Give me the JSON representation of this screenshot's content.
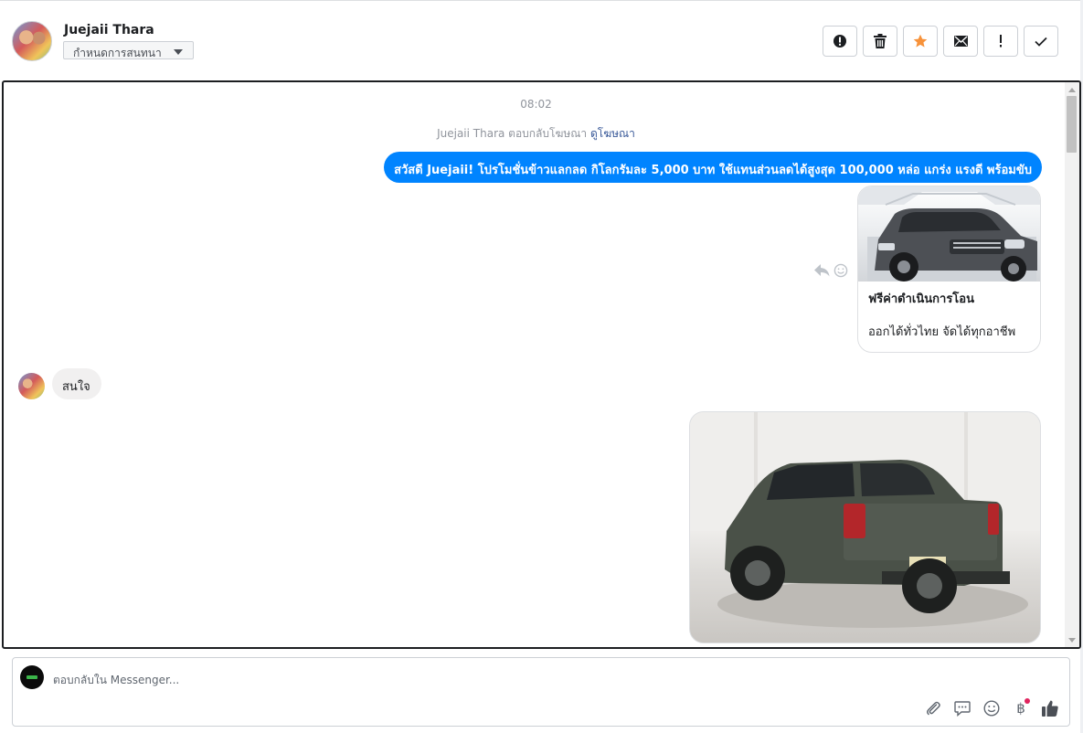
{
  "header": {
    "user_name": "Juejaii Thara",
    "label_select": "กำหนดการสนทนา",
    "toolbar": [
      {
        "name": "mark-spam-button",
        "icon": "alert-circle-icon"
      },
      {
        "name": "delete-button",
        "icon": "trash-icon"
      },
      {
        "name": "star-button",
        "icon": "star-icon",
        "color": "#f7923a"
      },
      {
        "name": "mark-unread-button",
        "icon": "envelope-icon"
      },
      {
        "name": "mark-important-button",
        "icon": "exclamation-icon"
      },
      {
        "name": "mark-done-button",
        "icon": "check-icon"
      }
    ]
  },
  "conversation": {
    "timestamp": "08:02",
    "ad_reply_text": "Juejaii Thara ตอบกลับโฆษณา",
    "ad_reply_link": "ดูโฆษณา",
    "outgoing_message": "สวัสดี Juejaii! โปรโมชั่นข้าวแลกลด กิโลกรัมละ 5,000 บาท ใช้แทนส่วนลดได้สูงสุด 100,000  หล่อ แกร่ง แรงดี พร้อมขับ",
    "card": {
      "title": "ฟรีค่าดำเนินการโอน",
      "subtitle": "ออกได้ทั่วไทย จัดได้ทุกอาชีพ"
    },
    "incoming_message": "สนใจ"
  },
  "composer": {
    "placeholder": "ตอบกลับใน Messenger..."
  },
  "colors": {
    "accent": "#0084ff",
    "incoming_bubble": "#f1f0f0",
    "star": "#f7923a",
    "notification_dot": "#e0245e"
  }
}
